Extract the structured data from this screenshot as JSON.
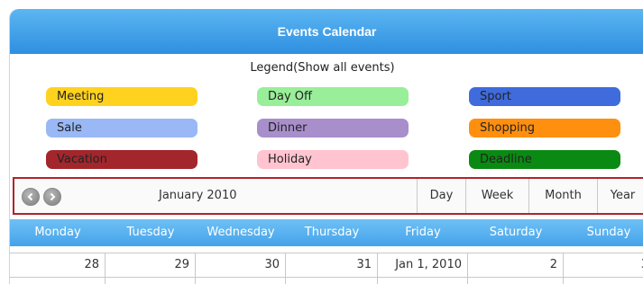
{
  "header": {
    "title": "Events Calendar"
  },
  "legend": {
    "title": "Legend(Show all events)",
    "items": [
      {
        "label": "Meeting",
        "color": "#ffd21f"
      },
      {
        "label": "Day Off",
        "color": "#99ee99"
      },
      {
        "label": "Sport",
        "color": "#3f6bdc"
      },
      {
        "label": "Sale",
        "color": "#99b8f5"
      },
      {
        "label": "Dinner",
        "color": "#a88fcc"
      },
      {
        "label": "Shopping",
        "color": "#ff8f0f"
      },
      {
        "label": "Vacation",
        "color": "#a3262c"
      },
      {
        "label": "Holiday",
        "color": "#ffc4cf"
      },
      {
        "label": "Deadline",
        "color": "#0a8a12"
      }
    ]
  },
  "toolbar": {
    "prev_icon": "chevron-left-icon",
    "next_icon": "chevron-right-icon",
    "month_label": "January 2010",
    "views": [
      "Day",
      "Week",
      "Month",
      "Year"
    ]
  },
  "weekdays": [
    "Monday",
    "Tuesday",
    "Wednesday",
    "Thursday",
    "Friday",
    "Saturday",
    "Sunday"
  ],
  "dates": [
    "28",
    "29",
    "30",
    "31",
    "Jan 1, 2010",
    "2",
    "3"
  ],
  "colors": {
    "accent": "#2f8fe0",
    "highlight_border": "#b0232a"
  }
}
